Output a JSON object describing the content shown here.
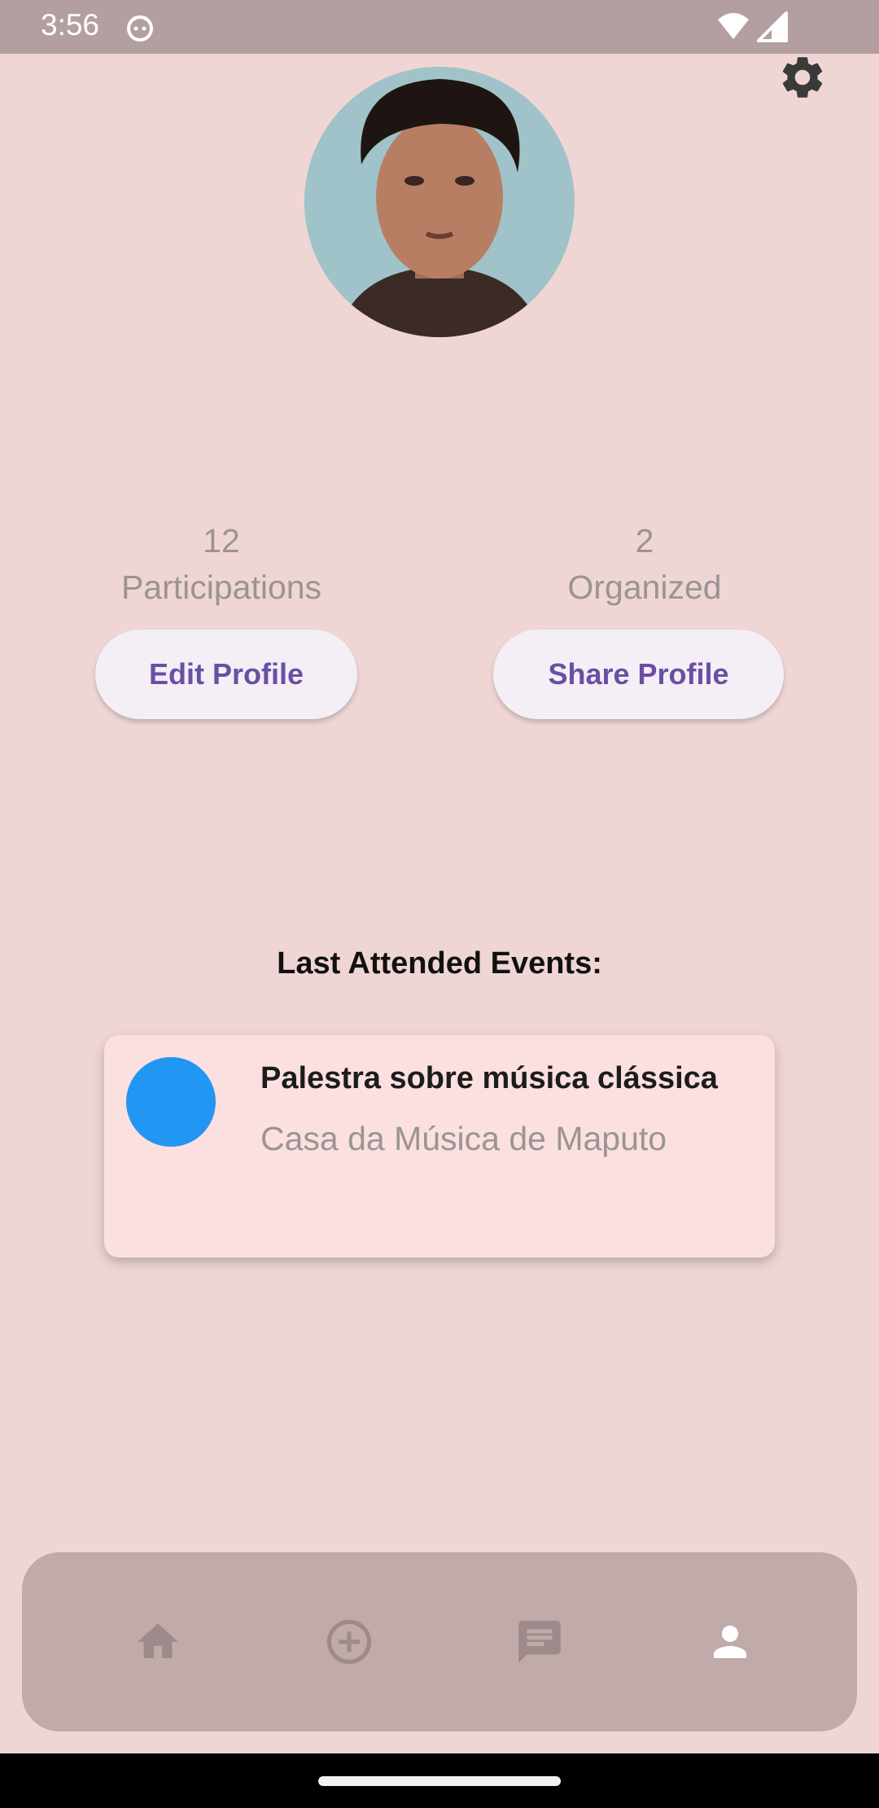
{
  "status_bar": {
    "time": "3:56",
    "icons": [
      "cat-face-icon",
      "wifi-icon",
      "cellular-signal-icon"
    ]
  },
  "header": {
    "settings_icon": "gear-icon"
  },
  "profile": {
    "avatar": "profile-photo",
    "stats": {
      "participations_count": "12",
      "participations_label": "Participations",
      "organized_count": "2",
      "organized_label": "Organized"
    },
    "edit_button_label": "Edit Profile",
    "share_button_label": "Share Profile"
  },
  "events": {
    "section_title": "Last Attended Events:",
    "items": [
      {
        "title": "Palestra sobre música clássica",
        "location": "Casa da Música de Maputo",
        "dot_color": "#2196F3"
      }
    ]
  },
  "bottom_nav": {
    "items": [
      {
        "icon": "home-icon",
        "active": false
      },
      {
        "icon": "add-circle-icon",
        "active": false
      },
      {
        "icon": "chat-icon",
        "active": false
      },
      {
        "icon": "person-icon",
        "active": true
      }
    ]
  },
  "colors": {
    "background": "#EFD6D4",
    "status_bar": "#B39FA0",
    "button_text": "#6A4FA3",
    "nav_bar": "#C1AAAA",
    "nav_active": "#FFFFFF",
    "nav_inactive": "#9E8A8A"
  }
}
